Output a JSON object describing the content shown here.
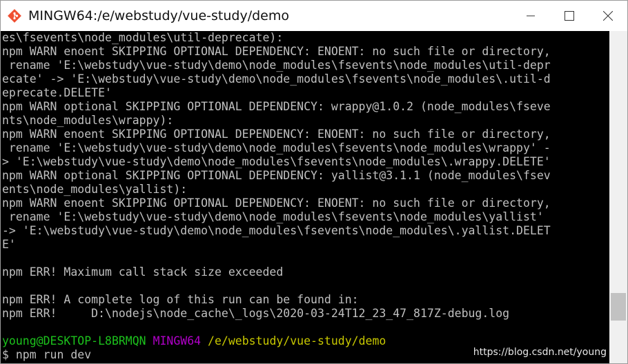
{
  "window": {
    "title": "MINGW64:/e/webstudy/vue-study/demo",
    "app_icon": "git-bash-diamond-icon",
    "controls": [
      "minimize-icon",
      "maximize-icon",
      "close-icon"
    ]
  },
  "terminal": {
    "lines": [
      [
        {
          "text": "es\\fsevents\\node_modules\\util-deprecate):",
          "color": "white"
        }
      ],
      [
        {
          "text": "npm WARN enoent SKIPPING OPTIONAL DEPENDENCY: ENOENT: no such file or directory,",
          "color": "white"
        }
      ],
      [
        {
          "text": " rename 'E:\\webstudy\\vue-study\\demo\\node_modules\\fsevents\\node_modules\\util-depr",
          "color": "white"
        }
      ],
      [
        {
          "text": "ecate' -> 'E:\\webstudy\\vue-study\\demo\\node_modules\\fsevents\\node_modules\\.util-d",
          "color": "white"
        }
      ],
      [
        {
          "text": "eprecate.DELETE'",
          "color": "white"
        }
      ],
      [
        {
          "text": "npm WARN optional SKIPPING OPTIONAL DEPENDENCY: wrappy@1.0.2 (node_modules\\fseve",
          "color": "white"
        }
      ],
      [
        {
          "text": "nts\\node_modules\\wrappy):",
          "color": "white"
        }
      ],
      [
        {
          "text": "npm WARN enoent SKIPPING OPTIONAL DEPENDENCY: ENOENT: no such file or directory,",
          "color": "white"
        }
      ],
      [
        {
          "text": " rename 'E:\\webstudy\\vue-study\\demo\\node_modules\\fsevents\\node_modules\\wrappy' -",
          "color": "white"
        }
      ],
      [
        {
          "text": "> 'E:\\webstudy\\vue-study\\demo\\node_modules\\fsevents\\node_modules\\.wrappy.DELETE'",
          "color": "white"
        }
      ],
      [
        {
          "text": "npm WARN optional SKIPPING OPTIONAL DEPENDENCY: yallist@3.1.1 (node_modules\\fsev",
          "color": "white"
        }
      ],
      [
        {
          "text": "ents\\node_modules\\yallist):",
          "color": "white"
        }
      ],
      [
        {
          "text": "npm WARN enoent SKIPPING OPTIONAL DEPENDENCY: ENOENT: no such file or directory,",
          "color": "white"
        }
      ],
      [
        {
          "text": " rename 'E:\\webstudy\\vue-study\\demo\\node_modules\\fsevents\\node_modules\\yallist'",
          "color": "white"
        }
      ],
      [
        {
          "text": "-> 'E:\\webstudy\\vue-study\\demo\\node_modules\\fsevents\\node_modules\\.yallist.DELET",
          "color": "white"
        }
      ],
      [
        {
          "text": "E'",
          "color": "white"
        }
      ],
      [
        {
          "text": "",
          "color": "white"
        }
      ],
      [
        {
          "text": "npm ERR! Maximum call stack size exceeded",
          "color": "white"
        }
      ],
      [
        {
          "text": "",
          "color": "white"
        }
      ],
      [
        {
          "text": "npm ERR! A complete log of this run can be found in:",
          "color": "white"
        }
      ],
      [
        {
          "text": "npm ERR!     D:\\nodejs\\node_cache\\_logs\\2020-03-24T12_23_47_817Z-debug.log",
          "color": "white"
        }
      ],
      [
        {
          "text": "",
          "color": "white"
        }
      ],
      [
        {
          "text": "young@DESKTOP-L8BRMQN",
          "color": "green"
        },
        {
          "text": " ",
          "color": "white"
        },
        {
          "text": "MINGW64",
          "color": "magenta"
        },
        {
          "text": " ",
          "color": "white"
        },
        {
          "text": "/e/webstudy/vue-study/demo",
          "color": "yellow"
        }
      ],
      [
        {
          "text": "$ npm run dev",
          "color": "white"
        }
      ]
    ]
  },
  "watermark": "https://blog.csdn.net/young",
  "colors": {
    "background": "#000000",
    "text": "#c0c0c0",
    "prompt_user": "#1cc21c",
    "prompt_system": "#b000c8",
    "prompt_path": "#c8c800"
  }
}
